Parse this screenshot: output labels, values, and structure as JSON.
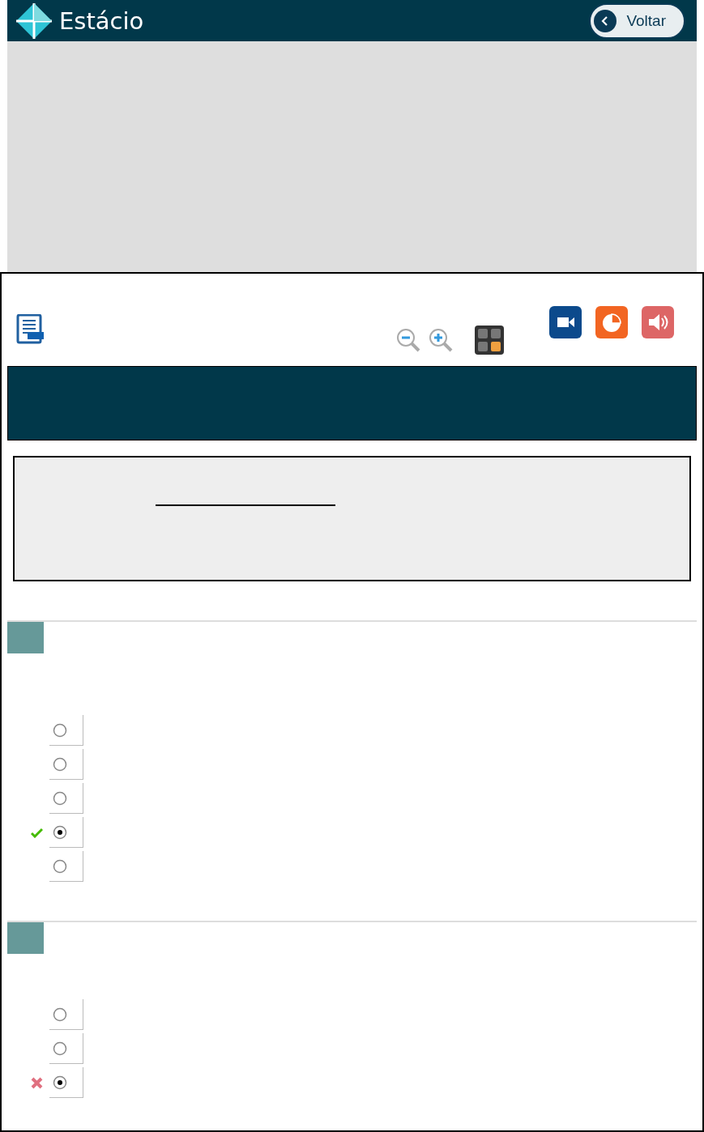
{
  "header": {
    "logo_text": "Estácio",
    "back_button": "Voltar"
  },
  "questions": [
    {
      "options": [
        {
          "selected": false,
          "kind": "plain"
        },
        {
          "selected": false,
          "kind": "plain"
        },
        {
          "selected": false,
          "kind": "plain"
        },
        {
          "selected": true,
          "kind": "correct"
        },
        {
          "selected": false,
          "kind": "plain"
        }
      ]
    },
    {
      "options": [
        {
          "selected": false,
          "kind": "plain"
        },
        {
          "selected": false,
          "kind": "plain"
        },
        {
          "selected": true,
          "kind": "wrong"
        }
      ]
    }
  ]
}
